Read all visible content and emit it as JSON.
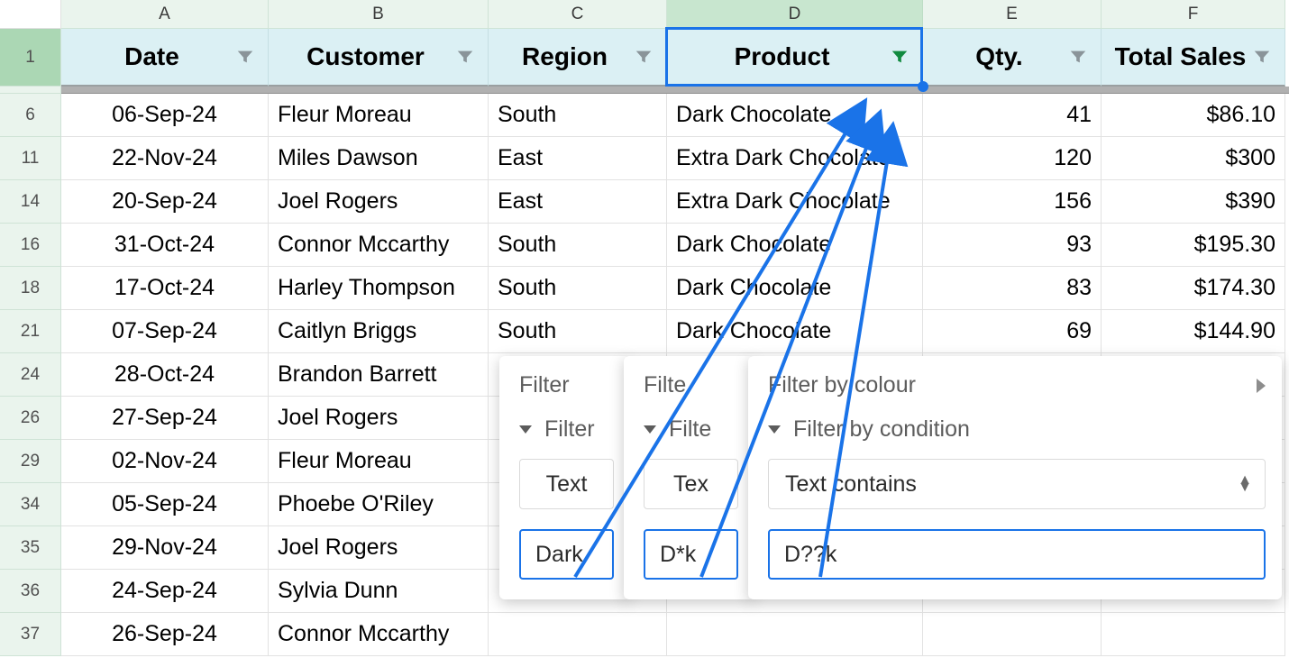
{
  "columns": {
    "A": "A",
    "B": "B",
    "C": "C",
    "D": "D",
    "E": "E",
    "F": "F"
  },
  "headers": {
    "date": "Date",
    "customer": "Customer",
    "region": "Region",
    "product": "Product",
    "qty": "Qty.",
    "total": "Total Sales"
  },
  "rowNumbers": [
    "1",
    "6",
    "11",
    "14",
    "16",
    "18",
    "21",
    "24",
    "26",
    "29",
    "34",
    "35",
    "36",
    "37"
  ],
  "rows": [
    {
      "date": "06-Sep-24",
      "customer": "Fleur Moreau",
      "region": "South",
      "product": "Dark Chocolate",
      "qty": "41",
      "total": "$86.10"
    },
    {
      "date": "22-Nov-24",
      "customer": "Miles Dawson",
      "region": "East",
      "product": "Extra Dark Chocolate",
      "qty": "120",
      "total": "$300"
    },
    {
      "date": "20-Sep-24",
      "customer": "Joel Rogers",
      "region": "East",
      "product": "Extra Dark Chocolate",
      "qty": "156",
      "total": "$390"
    },
    {
      "date": "31-Oct-24",
      "customer": "Connor Mccarthy",
      "region": "South",
      "product": "Dark Chocolate",
      "qty": "93",
      "total": "$195.30"
    },
    {
      "date": "17-Oct-24",
      "customer": "Harley Thompson",
      "region": "South",
      "product": "Dark Chocolate",
      "qty": "83",
      "total": "$174.30"
    },
    {
      "date": "07-Sep-24",
      "customer": "Caitlyn Briggs",
      "region": "South",
      "product": "Dark Chocolate",
      "qty": "69",
      "total": "$144.90"
    },
    {
      "date": "28-Oct-24",
      "customer": "Brandon Barrett",
      "region": "",
      "product": "",
      "qty": "",
      "total": ""
    },
    {
      "date": "27-Sep-24",
      "customer": "Joel Rogers",
      "region": "",
      "product": "",
      "qty": "",
      "total": ""
    },
    {
      "date": "02-Nov-24",
      "customer": "Fleur Moreau",
      "region": "",
      "product": "",
      "qty": "",
      "total": ""
    },
    {
      "date": "05-Sep-24",
      "customer": "Phoebe O'Riley",
      "region": "",
      "product": "",
      "qty": "",
      "total": ""
    },
    {
      "date": "29-Nov-24",
      "customer": "Joel Rogers",
      "region": "",
      "product": "",
      "qty": "",
      "total": ""
    },
    {
      "date": "24-Sep-24",
      "customer": "Sylvia Dunn",
      "region": "",
      "product": "",
      "qty": "",
      "total": ""
    },
    {
      "date": "26-Sep-24",
      "customer": "Connor Mccarthy",
      "region": "",
      "product": "",
      "qty": "",
      "total": ""
    }
  ],
  "popup": {
    "filterByColour": "Filter by colour",
    "filterByCondition": "Filter by condition",
    "filterLabelShort": "Filter",
    "filteShort": "Filte",
    "conditionOption": "Text contains",
    "textShort": "Text",
    "texShort": "Tex",
    "input1": "Dark",
    "input2": "D*k",
    "input3": "D??k"
  }
}
